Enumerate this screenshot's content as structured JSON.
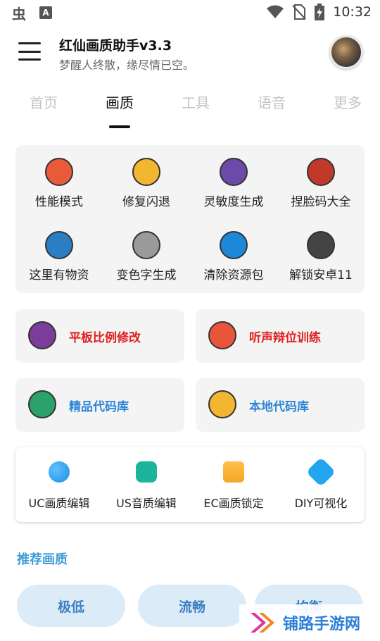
{
  "status_bar": {
    "time": "10:32",
    "left_icons": [
      "bug-icon",
      "a-icon"
    ],
    "right_icons": [
      "wifi-icon",
      "no-sim-icon",
      "battery-charging-icon"
    ]
  },
  "header": {
    "title": "红仙画质助手v3.3",
    "subtitle": "梦醒人终散，缘尽情已空。"
  },
  "tabs": [
    {
      "label": "首页"
    },
    {
      "label": "画质",
      "active": true
    },
    {
      "label": "工具"
    },
    {
      "label": "语音"
    },
    {
      "label": "更多"
    }
  ],
  "grid": [
    {
      "label": "性能模式",
      "icon": "ping-pong-icon",
      "color": "#e85a3a"
    },
    {
      "label": "修复闪退",
      "icon": "phone-icon",
      "color": "#f2b630"
    },
    {
      "label": "灵敏度生成",
      "icon": "pill-icon",
      "color": "#6b4aa8"
    },
    {
      "label": "捏脸码大全",
      "icon": "cherries-icon",
      "color": "#c0392b"
    },
    {
      "label": "这里有物资",
      "icon": "dollar-icon",
      "color": "#2a7fc4"
    },
    {
      "label": "变色字生成",
      "icon": "sushi-icon",
      "color": "#9a9a9a"
    },
    {
      "label": "清除资源包",
      "icon": "snowflake-icon",
      "color": "#1e88d8"
    },
    {
      "label": "解锁安卓11",
      "icon": "laptop-icon",
      "color": "#444444"
    }
  ],
  "features": [
    {
      "label": "平板比例修改",
      "icon": "gameboy-icon",
      "color": "#e02020",
      "icon_color": "#7a3d9a"
    },
    {
      "label": "听声辩位训练",
      "icon": "telescope-icon",
      "color": "#e02020",
      "icon_color": "#e8553a"
    },
    {
      "label": "精品代码库",
      "icon": "test-tubes-icon",
      "color": "#2e86d6",
      "icon_color": "#2aa26a"
    },
    {
      "label": "本地代码库",
      "icon": "monitor-icon",
      "color": "#2e86d6",
      "icon_color": "#f2b630"
    }
  ],
  "tools": [
    {
      "label": "UC画质编辑",
      "icon": "blue-circle-icon",
      "color": "#1a8fe0"
    },
    {
      "label": "US音质编辑",
      "icon": "teal-badge-icon",
      "color": "#1bb59c"
    },
    {
      "label": "EC画质锁定",
      "icon": "orange-square-icon",
      "color": "#f5a623"
    },
    {
      "label": "DIY可视化",
      "icon": "cross-icon",
      "color": "#22a6f0"
    }
  ],
  "section": {
    "title": "推荐画质"
  },
  "quality_options": [
    {
      "label": "极低"
    },
    {
      "label": "流畅"
    },
    {
      "label": "均衡"
    }
  ],
  "watermark": {
    "text": "铺路手游网"
  },
  "accent": "#3e9bd6"
}
